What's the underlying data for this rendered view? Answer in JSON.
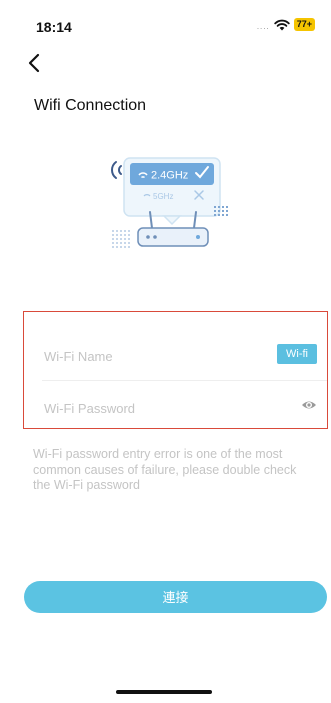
{
  "status_bar": {
    "time": "18:14",
    "signal": "....",
    "battery": "77+"
  },
  "header": {
    "title": "Wifi Connection"
  },
  "illustration": {
    "band_24": "2.4GHz",
    "band_5": "5GHz"
  },
  "form": {
    "name_placeholder": "Wi-Fi Name",
    "name_value": "",
    "wifi_chip_label": "Wi-fi",
    "password_placeholder": "Wi-Fi Password",
    "password_value": ""
  },
  "hint": {
    "lines": [
      "Wi-Fi password entry error is one of the most",
      "common causes of failure, please double check",
      "the Wi-Fi password"
    ]
  },
  "actions": {
    "connect_label": "連接"
  },
  "colors": {
    "accent": "#5bc3e2",
    "chip": "#5bbfe0",
    "error_border": "#d94a3a",
    "placeholder": "#c4c4c4",
    "battery": "#f5c400"
  }
}
